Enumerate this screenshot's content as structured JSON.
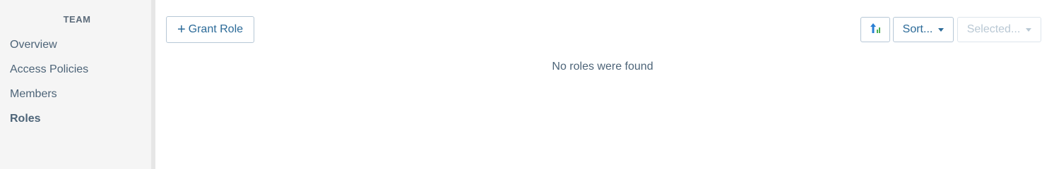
{
  "sidebar": {
    "heading": "TEAM",
    "items": [
      {
        "label": "Overview"
      },
      {
        "label": "Access Policies"
      },
      {
        "label": "Members"
      },
      {
        "label": "Roles"
      }
    ]
  },
  "toolbar": {
    "grant_plus": "+",
    "grant_label": "Grant Role",
    "sort_label": "Sort...",
    "selected_label": "Selected..."
  },
  "main": {
    "empty_message": "No roles were found"
  },
  "colors": {
    "accent": "#2b6a98",
    "icon_blue": "#2a7fd4",
    "icon_green": "#4caf50"
  },
  "icons": {
    "sort_direction": "sort-ascending-icon"
  }
}
